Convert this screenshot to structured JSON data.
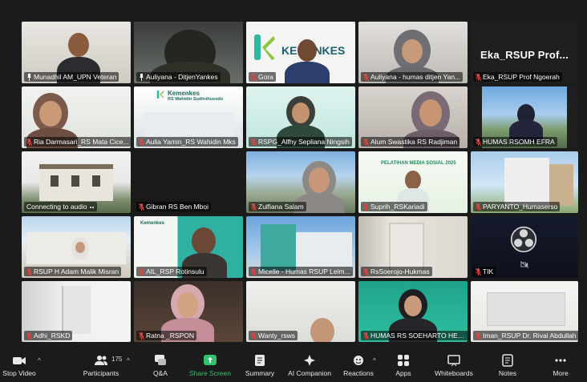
{
  "tiles": [
    {
      "name": "Munadhil AM_UPN Veteran",
      "pinned": true,
      "muted": false
    },
    {
      "name": "Auliyana - DitjenYankes",
      "pinned": true,
      "muted": false
    },
    {
      "name": "Gora",
      "pinned": false,
      "muted": true
    },
    {
      "name": "Auliyana - humas ditjen Yan...",
      "pinned": false,
      "muted": true
    },
    {
      "name": "Eka_RSUP Prof Ngoerah",
      "big_name": "Eka_RSUP Prof...",
      "pinned": false,
      "muted": true
    },
    {
      "name": "Ria Darmasari_RS Mata Cice...",
      "pinned": false,
      "muted": true
    },
    {
      "name": "Aulia Yamin_RS Wahidin Mks",
      "pinned": false,
      "muted": true,
      "banner_title": "Kemenkes",
      "banner_sub": "RS Wahidin Sudirohusodo"
    },
    {
      "name": "RSPG_Alfhy Sepliana Ningsih",
      "pinned": false,
      "muted": true
    },
    {
      "name": "Alum Swastika RS Radjiman",
      "pinned": false,
      "muted": true
    },
    {
      "name": "HUMAS RSOMH EFRA",
      "pinned": false,
      "muted": true
    },
    {
      "name": "Connecting to audio",
      "pinned": false,
      "muted": false,
      "connecting": true
    },
    {
      "name": "Gibran RS Ben Mboi",
      "pinned": false,
      "muted": true
    },
    {
      "name": "Zulfiana Salam",
      "pinned": false,
      "muted": true
    },
    {
      "name": "Suprih_RSKariadi",
      "pinned": false,
      "muted": true,
      "banner_title": "PELATIHAN MEDIA SOSIAL 2025"
    },
    {
      "name": "PARYANTO_Humaserso",
      "pinned": false,
      "muted": true
    },
    {
      "name": "RSUP H Adam Malik Misran",
      "pinned": false,
      "muted": true
    },
    {
      "name": "AIL_RSP Rotinsulu",
      "pinned": false,
      "muted": true,
      "banner_title": "Kemenkes"
    },
    {
      "name": "Micelle - Humas RSUP Leim...",
      "pinned": false,
      "muted": true
    },
    {
      "name": "RsSoerojo-Hukmas",
      "pinned": false,
      "muted": true
    },
    {
      "name": "TIK",
      "pinned": false,
      "muted": true
    },
    {
      "name": "Adhi_RSKD",
      "pinned": false,
      "muted": true
    },
    {
      "name": "Ratna _RSPON",
      "pinned": false,
      "muted": true
    },
    {
      "name": "Wanty_rsws",
      "pinned": false,
      "muted": true
    },
    {
      "name": "HUMAS RS SOEHARTO HEER...",
      "pinned": false,
      "muted": true
    },
    {
      "name": "Iman_RSUP Dr. Rivai Abdullah",
      "pinned": false,
      "muted": true
    }
  ],
  "gora_banner": "KEMENKES",
  "toolbar": {
    "stop_video": "Stop Video",
    "participants": "Participants",
    "participant_count": "175",
    "qa": "Q&A",
    "share_screen": "Share Screen",
    "summary": "Summary",
    "ai_companion": "AI Companion",
    "reactions": "Reactions",
    "apps": "Apps",
    "whiteboards": "Whiteboards",
    "notes": "Notes",
    "more": "More"
  },
  "colors": {
    "active_border": "#c5e05a",
    "share_green": "#33c26b",
    "muted_red": "#e0453c",
    "background": "#1b1b1b"
  }
}
